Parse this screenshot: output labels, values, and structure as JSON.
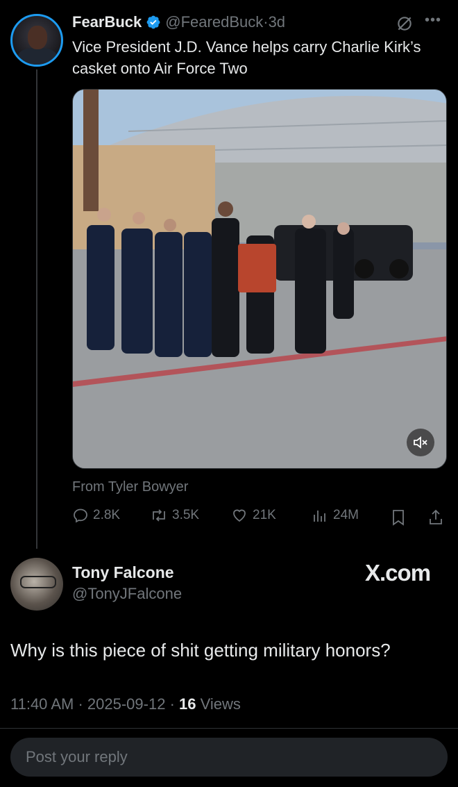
{
  "tweet": {
    "author_name": "FearBuck",
    "author_handle": "@FearedBuck",
    "separator": "·",
    "time_ago": "3d",
    "text": "Vice President J.D. Vance helps carry Charlie Kirk’s casket onto Air Force Two",
    "media_credit": "From Tyler Bowyer",
    "actions": {
      "replies": "2.8K",
      "reposts": "3.5K",
      "likes": "21K",
      "views": "24M"
    }
  },
  "reply": {
    "author_name": "Tony Falcone",
    "author_handle": "@TonyJFalcone",
    "watermark": "X.com",
    "text": "Why is this piece of shit getting military honors?",
    "time": "11:40 AM",
    "date": "2025-09-12",
    "separator": "·",
    "views_count": "16",
    "views_label": "Views"
  },
  "composer": {
    "placeholder": "Post your reply"
  },
  "colors": {
    "background": "#000000",
    "text": "#e7e9ea",
    "muted": "#71767b",
    "accent": "#1d9bf0",
    "divider": "#2f3336",
    "input_bg": "#202327"
  },
  "icons": [
    "verified-badge-icon",
    "grok-icon",
    "more-icon",
    "reply-icon",
    "repost-icon",
    "like-icon",
    "views-icon",
    "bookmark-icon",
    "share-icon",
    "mute-icon"
  ]
}
